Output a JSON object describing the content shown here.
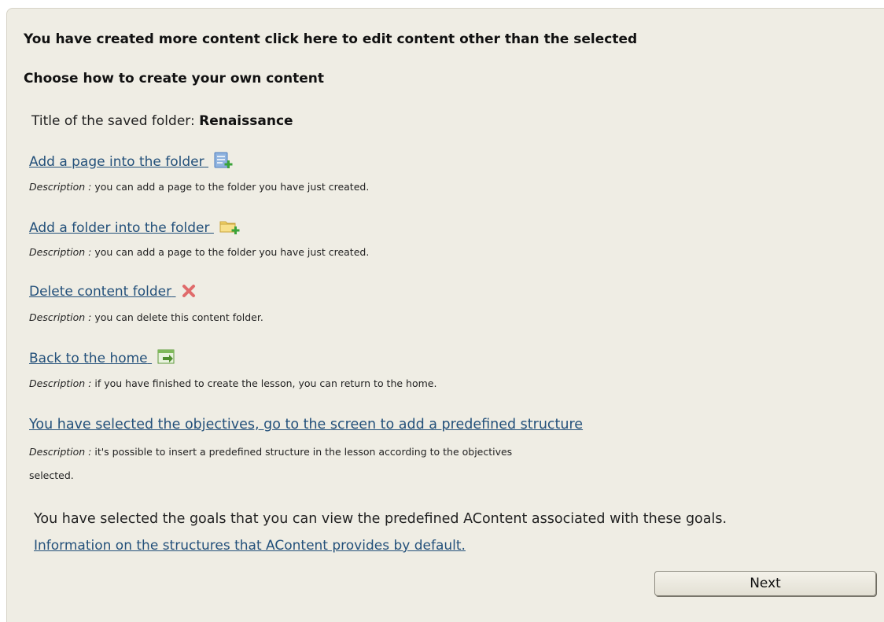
{
  "header": {
    "more_content": "You have created more content click here to edit content other than the selected",
    "choose_title": "Choose how to create your own content"
  },
  "folder": {
    "label": "Title of the saved folder:",
    "name": "Renaissance"
  },
  "description_label": "Description :",
  "actions": [
    {
      "label": "Add a page into the folder",
      "icon": "add-page-icon",
      "description": "you can add a page to the folder you have just created."
    },
    {
      "label": "Add a folder into the folder",
      "icon": "add-folder-icon",
      "description": "you can add a page to the folder you have just created."
    },
    {
      "label": "Delete content folder",
      "icon": "delete-icon",
      "description": "you can delete this content folder."
    },
    {
      "label": "Back to the home",
      "icon": "back-home-icon",
      "description": "if you have finished to create the lesson, you can return to the home."
    },
    {
      "label": "You have selected the objectives, go to the screen to add a predefined structure",
      "description": "it's possible to insert a predefined structure in the lesson according to the objectives",
      "description_cont": "selected."
    }
  ],
  "goals_note": "You have selected the goals that you can view the predefined AContent associated with these goals.",
  "info_link": "Information on the structures that AContent provides by default.",
  "next_button": "Next"
}
